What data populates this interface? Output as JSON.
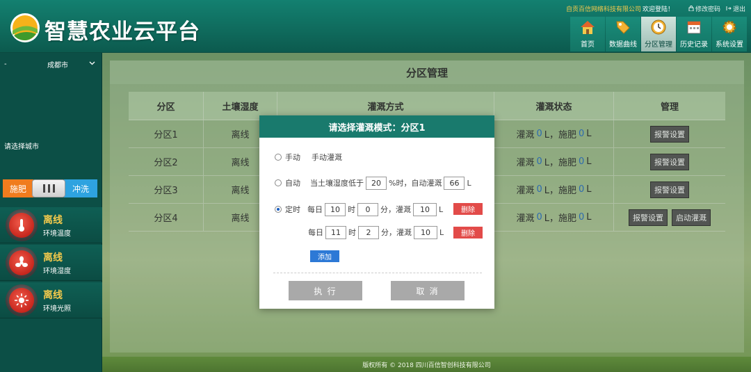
{
  "header": {
    "title": "智慧农业云平台",
    "company": "自贡百信网络科技有限公司",
    "welcome": "欢迎登陆！",
    "change_password": "修改密码",
    "logout": "退出"
  },
  "nav": [
    {
      "label": "首页",
      "icon": "home-icon",
      "active": false
    },
    {
      "label": "数据曲线",
      "icon": "tag-icon",
      "active": false
    },
    {
      "label": "分区管理",
      "icon": "clock-icon",
      "active": true
    },
    {
      "label": "历史记录",
      "icon": "calendar-icon",
      "active": false
    },
    {
      "label": "系统设置",
      "icon": "gear-icon",
      "active": false
    }
  ],
  "sidebar": {
    "dash": "-",
    "city": "成都市",
    "city_hint": "请选择城市",
    "toggle_left": "施肥",
    "toggle_right": "冲洗",
    "sensors": [
      {
        "status": "离线",
        "label": "环境温度",
        "icon": "thermometer-icon"
      },
      {
        "status": "离线",
        "label": "环境湿度",
        "icon": "fan-icon"
      },
      {
        "status": "离线",
        "label": "环境光照",
        "icon": "sun-icon"
      }
    ]
  },
  "panel": {
    "title": "分区管理",
    "headers": [
      "分区",
      "土壤湿度",
      "灌溉方式",
      "灌溉状态",
      "管理"
    ],
    "rows": [
      {
        "zone": "分区1",
        "humidity": "离线",
        "irr_label": "灌溉",
        "irr_val": "0",
        "irr_unit": "L，施肥",
        "fert_val": "0",
        "fert_unit": "L",
        "buttons": [
          "报警设置"
        ]
      },
      {
        "zone": "分区2",
        "humidity": "离线",
        "irr_label": "灌溉",
        "irr_val": "0",
        "irr_unit": "L，施肥",
        "fert_val": "0",
        "fert_unit": "L",
        "buttons": [
          "报警设置"
        ]
      },
      {
        "zone": "分区3",
        "humidity": "离线",
        "irr_label": "灌溉",
        "irr_val": "0",
        "irr_unit": "L，施肥",
        "fert_val": "0",
        "fert_unit": "L",
        "buttons": [
          "报警设置"
        ]
      },
      {
        "zone": "分区4",
        "humidity": "离线",
        "irr_label": "灌溉",
        "irr_val": "0",
        "irr_unit": "L，施肥",
        "fert_val": "0",
        "fert_unit": "L",
        "buttons": [
          "报警设置",
          "启动灌溉"
        ]
      }
    ]
  },
  "footer": {
    "copyright": "版权所有 © 2018 四川百信智创科技有限公司"
  },
  "modal": {
    "title": "请选择灌溉模式：分区1",
    "manual": {
      "label": "手动",
      "desc": "手动灌溉",
      "checked": false
    },
    "auto": {
      "label": "自动",
      "desc_prefix": "当土壤湿度低于",
      "threshold": "20",
      "desc_mid": "%时，自动灌溉",
      "amount": "66",
      "unit": "L",
      "checked": false
    },
    "timed": {
      "label": "定时",
      "checked": true,
      "schedules": [
        {
          "prefix": "每日",
          "hour": "10",
          "hour_unit": "时",
          "minute": "0",
          "minute_unit": "分，灌溉",
          "amount": "10",
          "unit": "L",
          "delete": "删除"
        },
        {
          "prefix": "每日",
          "hour": "11",
          "hour_unit": "时",
          "minute": "2",
          "minute_unit": "分，灌溉",
          "amount": "10",
          "unit": "L",
          "delete": "删除"
        }
      ],
      "add": "添加"
    },
    "execute": "执 行",
    "cancel": "取 消"
  }
}
